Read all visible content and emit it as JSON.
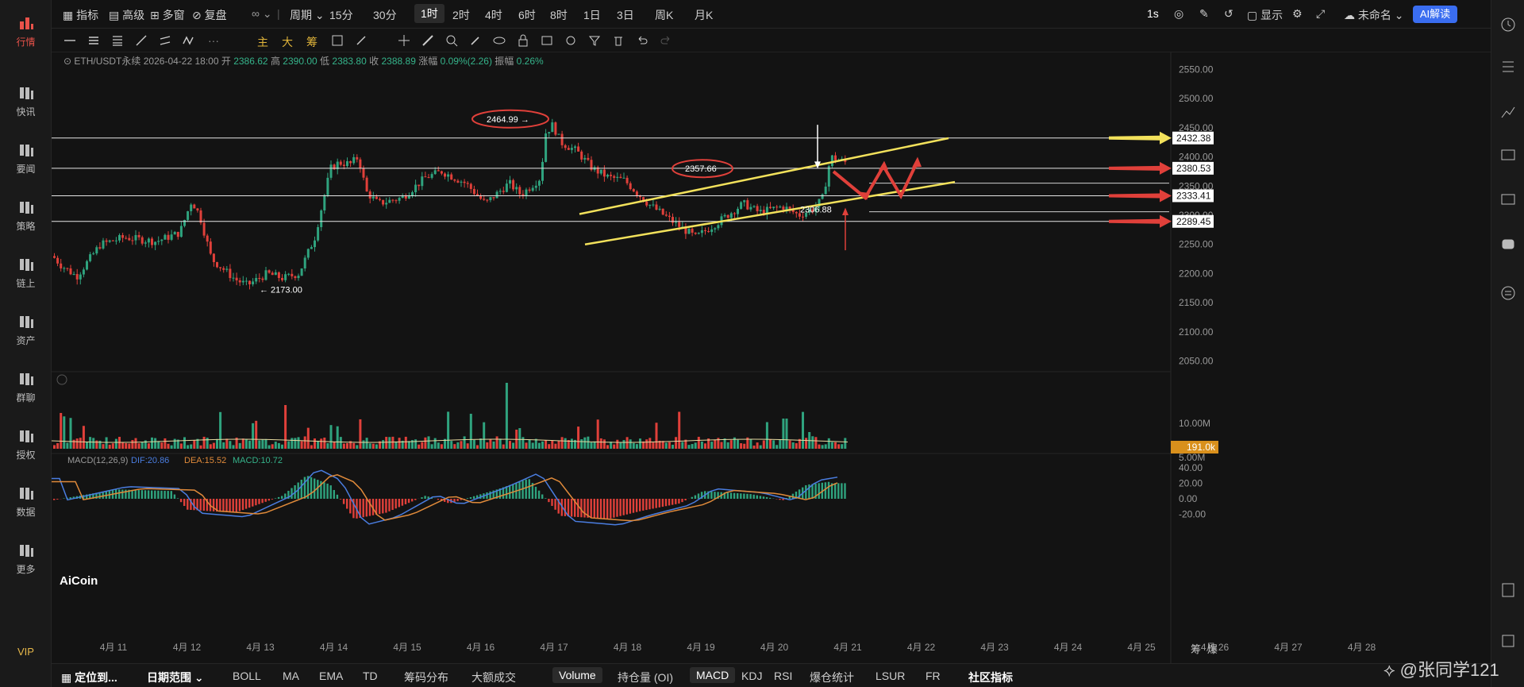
{
  "nav": [
    {
      "label": "行情",
      "icon": "bar-chart-icon",
      "active": true
    },
    {
      "label": "快讯",
      "icon": "news-flash-icon"
    },
    {
      "label": "要闻",
      "icon": "document-icon"
    },
    {
      "label": "策略",
      "icon": "robot-icon"
    },
    {
      "label": "链上",
      "icon": "chain-icon"
    },
    {
      "label": "资产",
      "icon": "wallet-icon"
    },
    {
      "label": "群聊",
      "icon": "chat-icon"
    },
    {
      "label": "授权",
      "icon": "key-icon"
    },
    {
      "label": "数据",
      "icon": "monitor-icon"
    },
    {
      "label": "更多",
      "icon": "grid-icon"
    }
  ],
  "vip": "VIP",
  "topbar": {
    "indicators": "指标",
    "advanced": "高级",
    "multi_window": "多窗",
    "replay": "复盘",
    "period": "周期",
    "intervals": [
      "15分",
      "30分",
      "1时",
      "2时",
      "4时",
      "6时",
      "8时",
      "1日",
      "3日",
      "周K",
      "月K"
    ],
    "active_interval": "1时",
    "realtime": "1s",
    "display": "显示",
    "layout_name": "未命名",
    "ai_button": "AI解读"
  },
  "drawbar": {
    "main": "主",
    "large": "大",
    "chips": "筹"
  },
  "info": {
    "symbol": "ETH/USDT永续",
    "datetime": "2026-04-22 18:00",
    "open_label": "开",
    "open": "2386.62",
    "high_label": "高",
    "high": "2390.00",
    "low_label": "低",
    "low": "2383.80",
    "close_label": "收",
    "close": "2388.89",
    "change_label": "涨幅",
    "change": "0.09%(2.26)",
    "amplitude_label": "振幅",
    "amplitude": "0.26%"
  },
  "chart_data": {
    "type": "candlestick",
    "price_axis": [
      "2550.00",
      "2500.00",
      "2450.00",
      "2400.00",
      "2350.00",
      "2300.00",
      "2250.00",
      "2200.00",
      "2150.00",
      "2100.00",
      "2050.00"
    ],
    "ylim": [
      2040,
      2560
    ],
    "x_labels": [
      "4月 11",
      "4月 12",
      "4月 13",
      "4月 14",
      "4月 15",
      "4月 16",
      "4月 17",
      "4月 18",
      "4月 19",
      "4月 20",
      "4月 21",
      "4月 22",
      "4月 23",
      "4月 24",
      "4月 25",
      "4月 26",
      "4月 27",
      "4月 28"
    ],
    "horizontal_levels": [
      {
        "value": 2432.38,
        "label": "2432.38",
        "arrow": "yellow"
      },
      {
        "value": 2380.53,
        "label": "2380.53",
        "arrow": "red"
      },
      {
        "value": 2333.41,
        "label": "2333.41",
        "arrow": "red"
      },
      {
        "value": 2289.45,
        "label": "2289.45",
        "arrow": "red"
      }
    ],
    "annotations": [
      {
        "text": "2464.99 →",
        "circled": true
      },
      {
        "text": "2357.66",
        "circled": true
      },
      {
        "text": "2306.88"
      },
      {
        "text": "← 2173.00"
      }
    ],
    "volume_axis": [
      "10.00M",
      "5.00M"
    ],
    "volume_last": "191.0k",
    "macd_label": "MACD(12,26,9)",
    "macd_dif": "DIF:20.86",
    "macd_dea": "DEA:15.52",
    "macd_value": "MACD:10.72",
    "macd_axis": [
      "40.00",
      "20.00",
      "0.00",
      "-20.00"
    ],
    "chip_labels": [
      "筹",
      "爆"
    ]
  },
  "colors": {
    "up": "#2fa37e",
    "down": "#e0403a",
    "yellow": "#f2e15b",
    "accent": "#3a6df0"
  },
  "logo": "AiCoin",
  "bottombar": {
    "locate": "定位到...",
    "date_range": "日期范围",
    "items": [
      "BOLL",
      "MA",
      "EMA",
      "TD",
      "筹码分布",
      "大额成交",
      "Volume",
      "持仓量 (OI)",
      "MACD",
      "KDJ",
      "RSI",
      "爆仓统计",
      "LSUR",
      "FR",
      "社区指标"
    ],
    "active": [
      "Volume",
      "MACD"
    ]
  },
  "watermark": "@张同学121"
}
